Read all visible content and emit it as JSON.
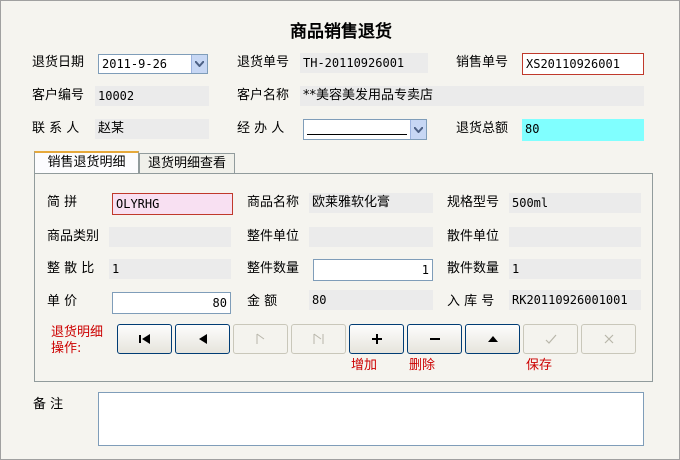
{
  "title": "商品销售退货",
  "header": {
    "return_date_label": "退货日期",
    "return_date_value": "2011-9-26",
    "return_no_label": "退货单号",
    "return_no_value": "TH-20110926001",
    "sales_no_label": "销售单号",
    "sales_no_value": "XS20110926001",
    "customer_no_label": "客户编号",
    "customer_no_value": "10002",
    "customer_name_label": "客户名称",
    "customer_name_value": "**美容美发用品专卖店",
    "contact_label": "联 系 人",
    "contact_value": "赵某",
    "handler_label": "经 办 人",
    "handler_value": "",
    "total_label": "退货总额",
    "total_value": "80"
  },
  "tabs": [
    {
      "label": "销售退货明细",
      "active": true
    },
    {
      "label": "退货明细查看",
      "active": false
    }
  ],
  "detail": {
    "pinyin_label": "简    拼",
    "pinyin_value": "OLYRHG",
    "product_name_label": "商品名称",
    "product_name_value": "欧莱雅软化膏",
    "spec_label": "规格型号",
    "spec_value": "500ml",
    "category_label": "商品类别",
    "category_value": "",
    "whole_unit_label": "整件单位",
    "whole_unit_value": "",
    "loose_unit_label": "散件单位",
    "loose_unit_value": "",
    "ratio_label": "整 散 比",
    "ratio_value": "1",
    "whole_qty_label": "整件数量",
    "whole_qty_value": "1",
    "loose_qty_label": "散件数量",
    "loose_qty_value": "1",
    "price_label": "单    价",
    "price_value": "80",
    "amount_label": "金    额",
    "amount_value": "80",
    "stock_no_label": "入 库 号",
    "stock_no_value": "RK20110926001001"
  },
  "ops": {
    "label": "退货明细操作:",
    "add_label": "增加",
    "delete_label": "删除",
    "save_label": "保存"
  },
  "remarks": {
    "label": "备    注",
    "value": ""
  },
  "colors": {
    "accent_red": "#cc0000",
    "pink_input": "#f8e0f2",
    "cyan_total": "#80ffff",
    "readonly_bg": "#ebebeb"
  }
}
